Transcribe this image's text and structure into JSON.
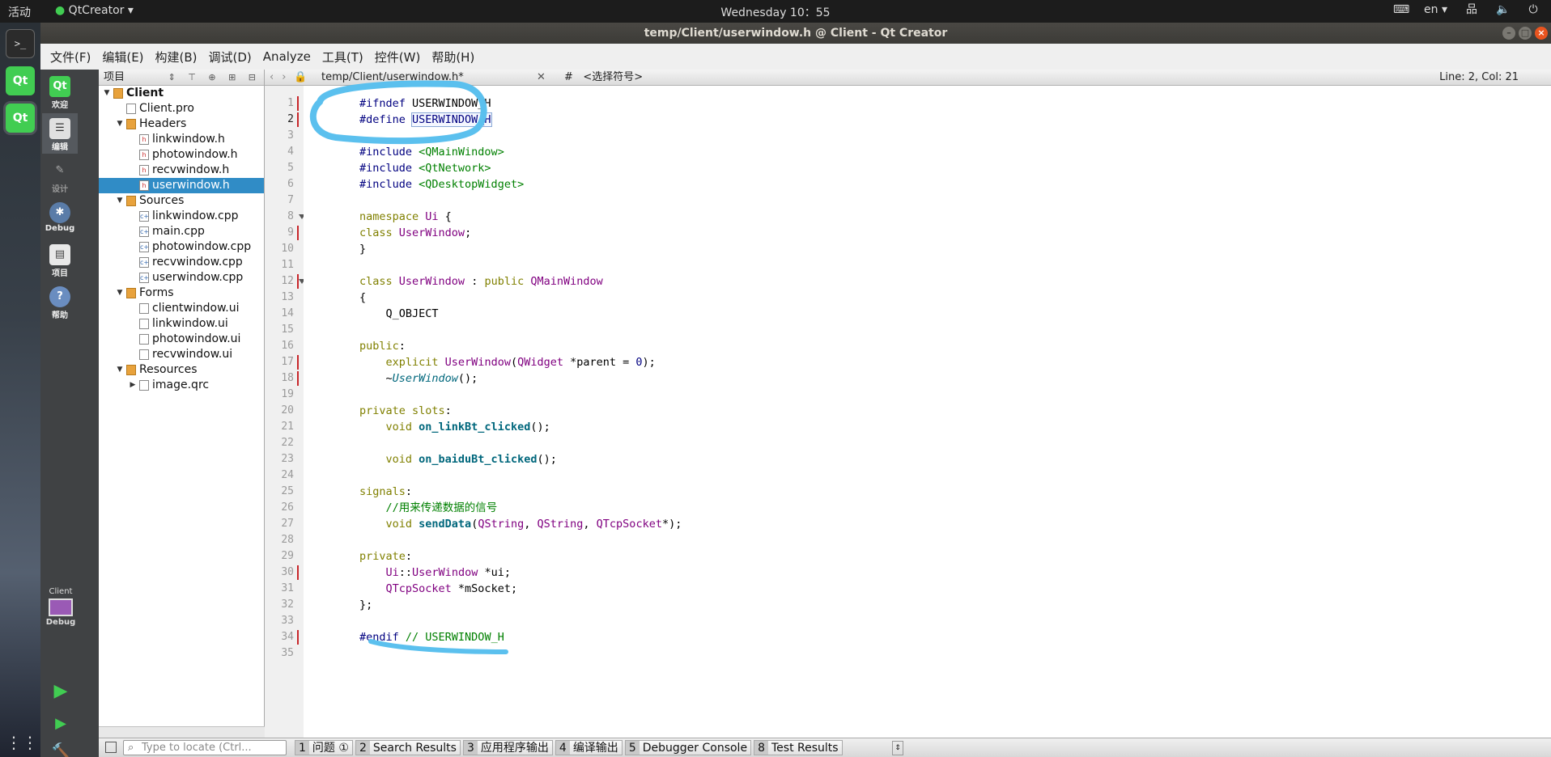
{
  "top_panel": {
    "activities": "活动",
    "app_name": "QtCreator ▾",
    "clock": "Wednesday 10：55",
    "lang": "en ▾"
  },
  "window": {
    "title": "temp/Client/userwindow.h @ Client - Qt Creator"
  },
  "menu": [
    "文件(F)",
    "编辑(E)",
    "构建(B)",
    "调试(D)",
    "Analyze",
    "工具(T)",
    "控件(W)",
    "帮助(H)"
  ],
  "modes": {
    "welcome": "欢迎",
    "edit": "编辑",
    "design": "设计",
    "debug": "Debug",
    "projects": "项目",
    "help": "帮助"
  },
  "kit": {
    "project": "Client",
    "config": "Debug"
  },
  "project_pane": {
    "title": "项目",
    "tree": [
      {
        "label": "Client",
        "depth": 0,
        "arrow": "▼",
        "icon": "folder",
        "bold": true
      },
      {
        "label": "Client.pro",
        "depth": 1,
        "arrow": "",
        "icon": "pro"
      },
      {
        "label": "Headers",
        "depth": 1,
        "arrow": "▼",
        "icon": "folder"
      },
      {
        "label": "linkwindow.h",
        "depth": 2,
        "arrow": "",
        "icon": "h"
      },
      {
        "label": "photowindow.h",
        "depth": 2,
        "arrow": "",
        "icon": "h"
      },
      {
        "label": "recvwindow.h",
        "depth": 2,
        "arrow": "",
        "icon": "h"
      },
      {
        "label": "userwindow.h",
        "depth": 2,
        "arrow": "",
        "icon": "h",
        "selected": true
      },
      {
        "label": "Sources",
        "depth": 1,
        "arrow": "▼",
        "icon": "folder"
      },
      {
        "label": "linkwindow.cpp",
        "depth": 2,
        "arrow": "",
        "icon": "cpp"
      },
      {
        "label": "main.cpp",
        "depth": 2,
        "arrow": "",
        "icon": "cpp"
      },
      {
        "label": "photowindow.cpp",
        "depth": 2,
        "arrow": "",
        "icon": "cpp"
      },
      {
        "label": "recvwindow.cpp",
        "depth": 2,
        "arrow": "",
        "icon": "cpp"
      },
      {
        "label": "userwindow.cpp",
        "depth": 2,
        "arrow": "",
        "icon": "cpp"
      },
      {
        "label": "Forms",
        "depth": 1,
        "arrow": "▼",
        "icon": "folder"
      },
      {
        "label": "clientwindow.ui",
        "depth": 2,
        "arrow": "",
        "icon": "ui"
      },
      {
        "label": "linkwindow.ui",
        "depth": 2,
        "arrow": "",
        "icon": "ui"
      },
      {
        "label": "photowindow.ui",
        "depth": 2,
        "arrow": "",
        "icon": "ui"
      },
      {
        "label": "recvwindow.ui",
        "depth": 2,
        "arrow": "",
        "icon": "ui"
      },
      {
        "label": "Resources",
        "depth": 1,
        "arrow": "▼",
        "icon": "folder"
      },
      {
        "label": "image.qrc",
        "depth": 2,
        "arrow": "▶",
        "icon": "pro"
      }
    ]
  },
  "editor": {
    "file_tab": "temp/Client/userwindow.h*",
    "symbol": "<选择符号>",
    "symbol_hash": "#",
    "position": "Line: 2, Col: 21",
    "current_line": 2,
    "modified_lines": [
      1,
      2,
      9,
      12,
      17,
      18,
      30,
      34
    ],
    "fold_lines": [
      8,
      12
    ],
    "lines": [
      [
        [
          "pp",
          "#ifndef "
        ],
        [
          "",
          "USERWINDOW_H"
        ]
      ],
      [
        [
          "pp",
          "#define "
        ],
        [
          "hl",
          "USERWINDOW_H"
        ]
      ],
      [],
      [
        [
          "pp",
          "#include "
        ],
        [
          "inc",
          "<QMainWindow>"
        ]
      ],
      [
        [
          "pp",
          "#include "
        ],
        [
          "inc",
          "<QtNetwork>"
        ]
      ],
      [
        [
          "pp",
          "#include "
        ],
        [
          "inc",
          "<QDesktopWidget>"
        ]
      ],
      [],
      [
        [
          "kw",
          "namespace "
        ],
        [
          "ty",
          "Ui"
        ],
        [
          "",
          " {"
        ]
      ],
      [
        [
          "kw",
          "class "
        ],
        [
          "ty",
          "UserWindow"
        ],
        [
          "",
          ";"
        ]
      ],
      [
        [
          "",
          "}"
        ]
      ],
      [],
      [
        [
          "kw",
          "class "
        ],
        [
          "ty",
          "UserWindow"
        ],
        [
          "",
          " : "
        ],
        [
          "kw",
          "public "
        ],
        [
          "ty",
          "QMainWindow"
        ]
      ],
      [
        [
          "",
          "{"
        ]
      ],
      [
        [
          "",
          "    Q_OBJECT"
        ]
      ],
      [],
      [
        [
          "kw",
          "public"
        ],
        [
          "",
          ":"
        ]
      ],
      [
        [
          "",
          "    "
        ],
        [
          "kw",
          "explicit "
        ],
        [
          "ty",
          "UserWindow"
        ],
        [
          "",
          "("
        ],
        [
          "ty",
          "QWidget"
        ],
        [
          "",
          " *parent = "
        ],
        [
          "num",
          "0"
        ],
        [
          "",
          ");"
        ]
      ],
      [
        [
          "",
          "    ~"
        ],
        [
          "it",
          "UserWindow"
        ],
        [
          "",
          "();"
        ]
      ],
      [],
      [
        [
          "kw",
          "private slots"
        ],
        [
          "",
          ":"
        ]
      ],
      [
        [
          "",
          "    "
        ],
        [
          "kw",
          "void "
        ],
        [
          "fn",
          "on_linkBt_clicked"
        ],
        [
          "",
          "();"
        ]
      ],
      [],
      [
        [
          "",
          "    "
        ],
        [
          "kw",
          "void "
        ],
        [
          "fn",
          "on_baiduBt_clicked"
        ],
        [
          "",
          "();"
        ]
      ],
      [],
      [
        [
          "kw",
          "signals"
        ],
        [
          "",
          ":"
        ]
      ],
      [
        [
          "",
          "    "
        ],
        [
          "cm",
          "//用来传递数据的信号"
        ]
      ],
      [
        [
          "",
          "    "
        ],
        [
          "kw",
          "void "
        ],
        [
          "fn",
          "sendData"
        ],
        [
          "",
          "("
        ],
        [
          "ty",
          "QString"
        ],
        [
          "",
          ", "
        ],
        [
          "ty",
          "QString"
        ],
        [
          "",
          ", "
        ],
        [
          "ty",
          "QTcpSocket"
        ],
        [
          "",
          "*);"
        ]
      ],
      [],
      [
        [
          "kw",
          "private"
        ],
        [
          "",
          ":"
        ]
      ],
      [
        [
          "",
          "    "
        ],
        [
          "ty",
          "Ui"
        ],
        [
          "",
          "::"
        ],
        [
          "ty",
          "UserWindow"
        ],
        [
          "",
          " *ui;"
        ]
      ],
      [
        [
          "",
          "    "
        ],
        [
          "ty",
          "QTcpSocket"
        ],
        [
          "",
          " *mSocket;"
        ]
      ],
      [
        [
          "",
          "};"
        ]
      ],
      [],
      [
        [
          "pp",
          "#endif "
        ],
        [
          "cm",
          "// USERWINDOW_H"
        ]
      ],
      []
    ]
  },
  "statusbar": {
    "locate_placeholder": "Type to locate (Ctrl...",
    "tabs": [
      {
        "n": "1",
        "label": "问题 ①"
      },
      {
        "n": "2",
        "label": "Search Results"
      },
      {
        "n": "3",
        "label": "应用程序输出"
      },
      {
        "n": "4",
        "label": "编译输出"
      },
      {
        "n": "5",
        "label": "Debugger Console"
      },
      {
        "n": "8",
        "label": "Test Results"
      }
    ]
  },
  "annotation_color": "#5bc0ee"
}
